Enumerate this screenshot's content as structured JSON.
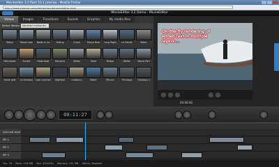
{
  "window": {
    "title": "Movieeditor 3.2 flash 10.1 preview - Mozilla Firefox",
    "url": "http://www.cinecut.com/demo/moviemovieeditor.html"
  },
  "app": {
    "title": "MovieEditor 3.2 Demo - MovieEditor"
  },
  "tabs": [
    {
      "label": "Videos",
      "active": true
    },
    {
      "label": "Images",
      "active": false
    },
    {
      "label": "Transitions",
      "active": false
    },
    {
      "label": "Sounds",
      "active": false
    },
    {
      "label": "Graphics",
      "active": false
    },
    {
      "label": "My media files",
      "active": false
    }
  ],
  "library": {
    "label": "Select library",
    "selected": "Vacation memories"
  },
  "thumbnails": [
    {
      "label": "Mitsui",
      "color": "#7a8fa4"
    },
    {
      "label": "Beach tele",
      "color": "#8da6b8"
    },
    {
      "label": "Boats in ne",
      "color": "#9aa6a8"
    },
    {
      "label": "Sailing",
      "color": "#6f8397"
    },
    {
      "label": "Crane",
      "color": "#a5b4bf"
    },
    {
      "label": "Pouco Blue",
      "color": "#5c86b0"
    },
    {
      "label": "Long flight",
      "color": "#b8c3cc"
    },
    {
      "label": "La Sendit",
      "color": "#4e6d8c"
    },
    {
      "label": "Billon",
      "color": "#8a8a8a"
    },
    {
      "label": "Nice boats",
      "color": "#6b7f8f"
    },
    {
      "label": "Sunset",
      "color": "#c8a070"
    },
    {
      "label": "Deep boat",
      "color": "#506070"
    },
    {
      "label": "Vesusius",
      "color": "#7d8a6a"
    },
    {
      "label": "Hilltop",
      "color": "#94a0a8"
    },
    {
      "label": "Sand",
      "color": "#b9b09a"
    },
    {
      "label": "Bridge",
      "color": "#707f8c"
    },
    {
      "label": "Dolfan",
      "color": "#5f7381"
    },
    {
      "label": "Vanna Port",
      "color": "#8898a6"
    },
    {
      "label": "Steak wait",
      "color": "#6e6256"
    },
    {
      "label": "La Ventana",
      "color": "#7390a8"
    },
    {
      "label": "Late summer",
      "color": "#b2a27e"
    },
    {
      "label": "Nightfall",
      "color": "#3e4652"
    },
    {
      "label": "Coliseum",
      "color": "#a79a82"
    },
    {
      "label": "Water",
      "color": "#4b7aa6"
    },
    {
      "label": "Mirrors",
      "color": "#6a7e90"
    },
    {
      "label": "Timelaps",
      "color": "#58626c"
    },
    {
      "label": "Timelaps 2",
      "color": "#4f5a64"
    }
  ],
  "preview": {
    "overlay_text": "On-the-fly rendering of edited text in multiple layers....",
    "time": "00:00:00"
  },
  "feedback_label": "Feedback",
  "transport": {
    "timecode": "00:11:27"
  },
  "tracks": [
    {
      "label": "Add new layer"
    },
    {
      "label": "PIP 1"
    },
    {
      "label": "PIP 2"
    },
    {
      "label": "PIP 3"
    }
  ],
  "status": {
    "fps": "Fps: 29",
    "mem": "Mem: 128 MB",
    "res": "Res: 320x240",
    "mode": "Memory: 141 MB",
    "status": "Status: Stopped"
  }
}
